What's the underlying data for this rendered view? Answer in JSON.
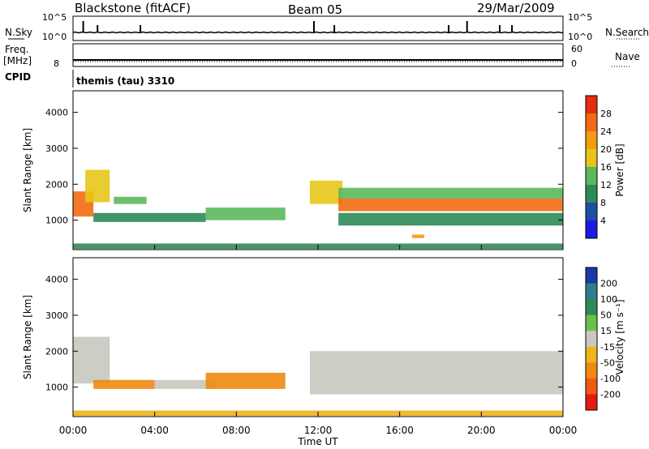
{
  "header": {
    "radar": "Blackstone (fitACF)",
    "beam": "Beam 05",
    "date": "29/Mar/2009"
  },
  "noise_panel": {
    "left_label": "N.Sky",
    "left_ticks": [
      "10^5",
      "10^0"
    ],
    "right_label": "N.Search",
    "right_ticks": [
      "10^5",
      "10^0"
    ]
  },
  "freq_panel": {
    "left_label_top": "Freq.",
    "left_label_bottom": "[MHz]",
    "left_tick": "8",
    "right_label": "Nave",
    "right_ticks": [
      "60",
      "0"
    ]
  },
  "cpid_panel": {
    "label": "CPID",
    "text": "themis (tau) 3310"
  },
  "power_panel": {
    "ylabel": "Slant Range [km]",
    "yticks": [
      "1000",
      "2000",
      "3000",
      "4000"
    ],
    "colorbar_label": "Power [dB]",
    "colorbar_ticks": [
      "4",
      "8",
      "12",
      "16",
      "20",
      "24",
      "28"
    ],
    "colorbar_colors": [
      "#1a1ae6",
      "#1e4fa0",
      "#2e8b57",
      "#5cb85c",
      "#e6c619",
      "#f39c12",
      "#f36b12",
      "#e62b12"
    ]
  },
  "velocity_panel": {
    "ylabel": "Slant Range [km]",
    "yticks": [
      "1000",
      "2000",
      "3000",
      "4000"
    ],
    "colorbar_label": "Velocity [m s⁻¹]",
    "colorbar_ticks": [
      "200",
      "100",
      "50",
      "15",
      "-15",
      "-50",
      "-100",
      "-200"
    ],
    "colorbar_colors": [
      "#1a3aa8",
      "#2e7d8c",
      "#2e8b57",
      "#6cc04a",
      "#c8c8c0",
      "#f0b41a",
      "#f08a12",
      "#f05a12",
      "#e61a12"
    ]
  },
  "xaxis": {
    "label": "Time UT",
    "ticks": [
      "00:00",
      "04:00",
      "08:00",
      "12:00",
      "16:00",
      "20:00",
      "00:00"
    ]
  },
  "chart_data": [
    {
      "type": "line",
      "title": "N.Sky / N.Search",
      "x_range_hours": [
        0,
        24
      ],
      "yscale": "log",
      "ylim": [
        1,
        100000
      ],
      "spikes_hours": [
        0.5,
        1.2,
        3.3,
        11.8,
        12.8,
        18.4,
        19.3,
        20.9,
        21.5
      ],
      "baseline": 10
    },
    {
      "type": "line",
      "title": "Freq. / Nave",
      "x_range_hours": [
        0,
        24
      ],
      "freq_mhz": 10.3,
      "nave": 8
    },
    {
      "type": "heatmap",
      "title": "Power [dB]",
      "x_range_hours": [
        0,
        24
      ],
      "ylim_km": [
        180,
        4600
      ],
      "regions": [
        {
          "t": [
            0.0,
            1.0
          ],
          "r": [
            1100,
            1800
          ],
          "value": 24
        },
        {
          "t": [
            0.6,
            1.8
          ],
          "r": [
            1500,
            2400
          ],
          "value": 18
        },
        {
          "t": [
            1.0,
            6.5
          ],
          "r": [
            950,
            1200
          ],
          "value": 10
        },
        {
          "t": [
            2.0,
            3.6
          ],
          "r": [
            1450,
            1650
          ],
          "value": 12
        },
        {
          "t": [
            6.5,
            10.4
          ],
          "r": [
            1000,
            1350
          ],
          "value": 12
        },
        {
          "t": [
            11.6,
            13.2
          ],
          "r": [
            1450,
            2100
          ],
          "value": 18
        },
        {
          "t": [
            13.0,
            24.0
          ],
          "r": [
            1250,
            1600
          ],
          "value": 24
        },
        {
          "t": [
            13.0,
            24.0
          ],
          "r": [
            1600,
            1900
          ],
          "value": 14
        },
        {
          "t": [
            13.0,
            24.0
          ],
          "r": [
            850,
            1200
          ],
          "value": 10
        },
        {
          "t": [
            0.0,
            24.0
          ],
          "r": [
            200,
            350
          ],
          "value": 8
        },
        {
          "t": [
            16.6,
            17.2
          ],
          "r": [
            500,
            600
          ],
          "value": 20
        }
      ]
    },
    {
      "type": "heatmap",
      "title": "Velocity [m s⁻¹]",
      "x_range_hours": [
        0,
        24
      ],
      "ylim_km": [
        180,
        4600
      ],
      "regions": [
        {
          "t": [
            0.0,
            1.8
          ],
          "r": [
            1100,
            2400
          ],
          "value": 0
        },
        {
          "t": [
            1.0,
            4.0
          ],
          "r": [
            950,
            1200
          ],
          "value": -50
        },
        {
          "t": [
            4.0,
            7.0
          ],
          "r": [
            950,
            1200
          ],
          "value": 0
        },
        {
          "t": [
            6.5,
            10.4
          ],
          "r": [
            950,
            1400
          ],
          "value": -50
        },
        {
          "t": [
            11.6,
            24.0
          ],
          "r": [
            800,
            2000
          ],
          "value": 0
        },
        {
          "t": [
            0.0,
            24.0
          ],
          "r": [
            200,
            350
          ],
          "value": -15
        }
      ]
    }
  ]
}
